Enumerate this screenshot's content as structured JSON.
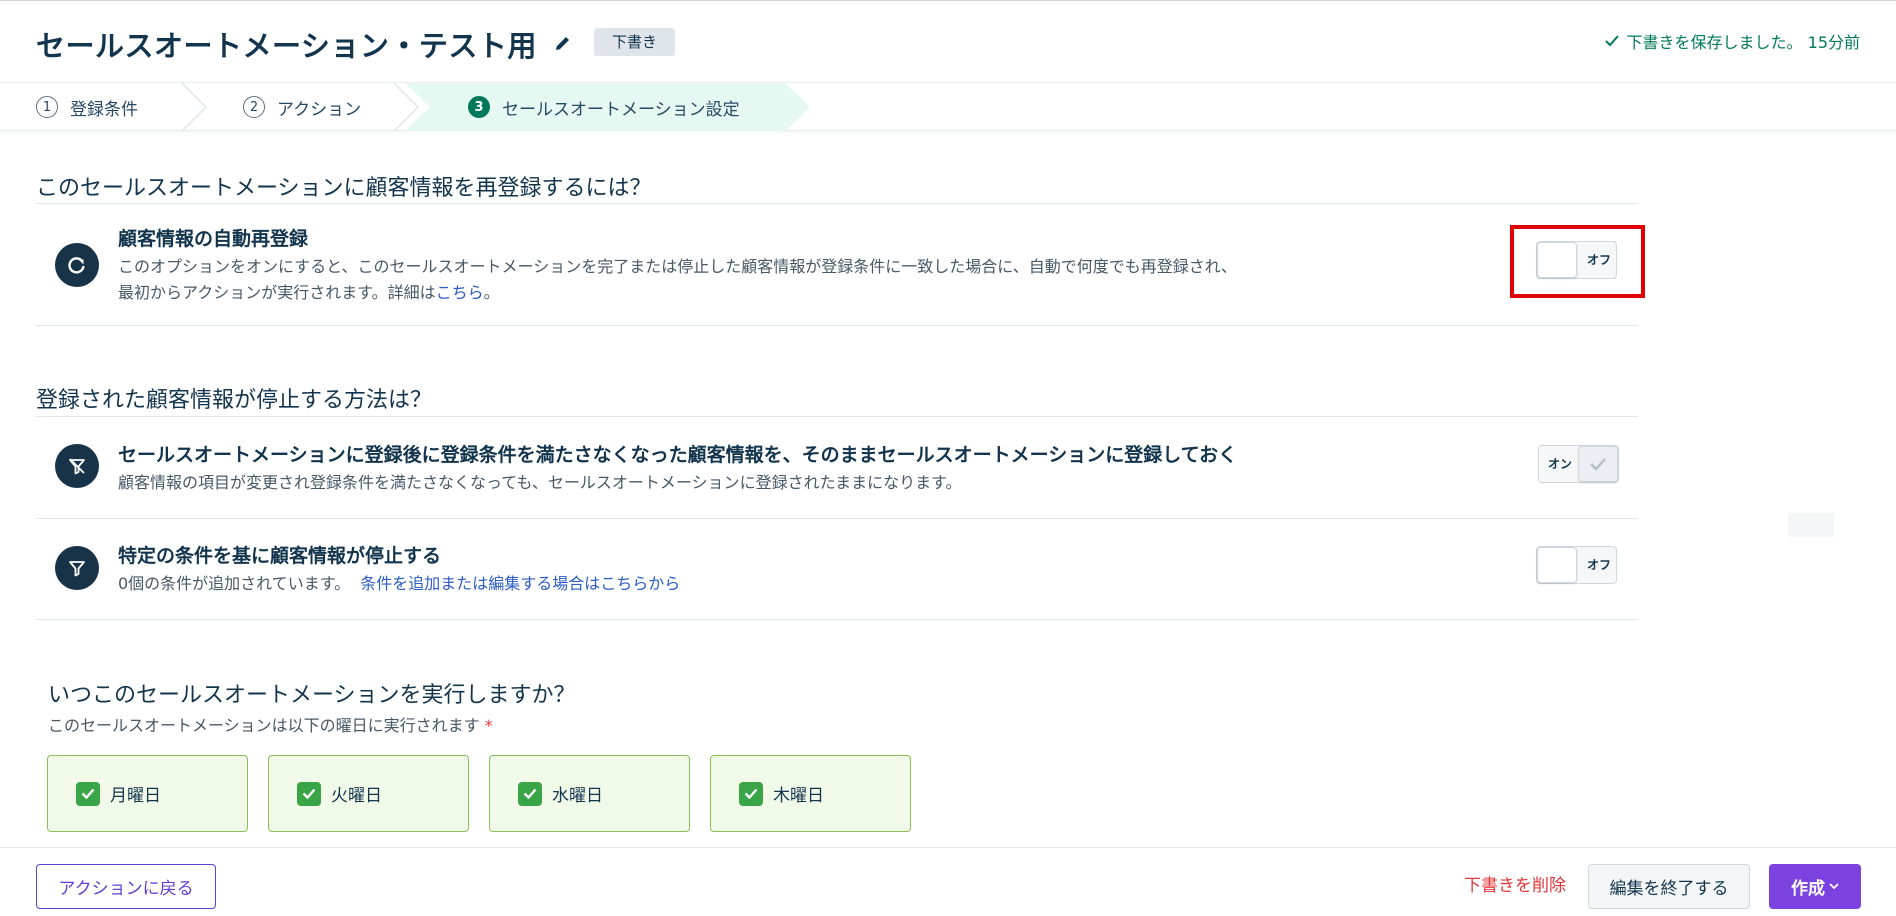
{
  "header": {
    "title": "セールスオートメーション・テスト用",
    "status_badge": "下書き",
    "saved_message": "下書きを保存しました。 15分前"
  },
  "stepper": {
    "steps": [
      {
        "number": "1",
        "label": "登録条件"
      },
      {
        "number": "2",
        "label": "アクション"
      },
      {
        "number": "3",
        "label": "セールスオートメーション設定"
      }
    ],
    "active_step": 3
  },
  "reenroll": {
    "heading": "このセールスオートメーションに顧客情報を再登録するには？",
    "title": "顧客情報の自動再登録",
    "desc_line1": "このオプションをオンにすると、このセールスオートメーションを完了または停止した顧客情報が登録条件に一致した場合に、自動で何度でも再登録され、",
    "desc_line2_prefix": "最初からアクションが実行されます。詳細は",
    "desc_link": "こちら",
    "desc_line2_suffix": "。",
    "toggle_label": "オフ",
    "toggle_state": "off"
  },
  "stop": {
    "heading": "登録された顧客情報が停止する方法は？",
    "option1": {
      "title": "セールスオートメーションに登録後に登録条件を満たさなくなった顧客情報を、そのままセールスオートメーションに登録しておく",
      "desc": "顧客情報の項目が変更され登録条件を満たさなくなっても、セールスオートメーションに登録されたままになります。",
      "toggle_label": "オン",
      "toggle_state": "on"
    },
    "option2": {
      "title": "特定の条件を基に顧客情報が停止する",
      "desc_prefix": "0個の条件が追加されています。",
      "desc_link": "条件を追加または編集する場合はこちらから",
      "toggle_label": "オフ",
      "toggle_state": "off"
    }
  },
  "schedule": {
    "heading": "いつこのセールスオートメーションを実行しますか？",
    "sublabel": "このセールスオートメーションは以下の曜日に実行されます",
    "required_mark": "*",
    "days": [
      "月曜日",
      "火曜日",
      "水曜日",
      "木曜日"
    ]
  },
  "footer": {
    "back_label": "アクションに戻る",
    "delete_label": "下書きを削除",
    "end_label": "編集を終了する",
    "create_label": "作成"
  },
  "colors": {
    "accent_green": "#00795b",
    "primary_purple": "#7b42e0",
    "highlight_red": "#e00000"
  }
}
